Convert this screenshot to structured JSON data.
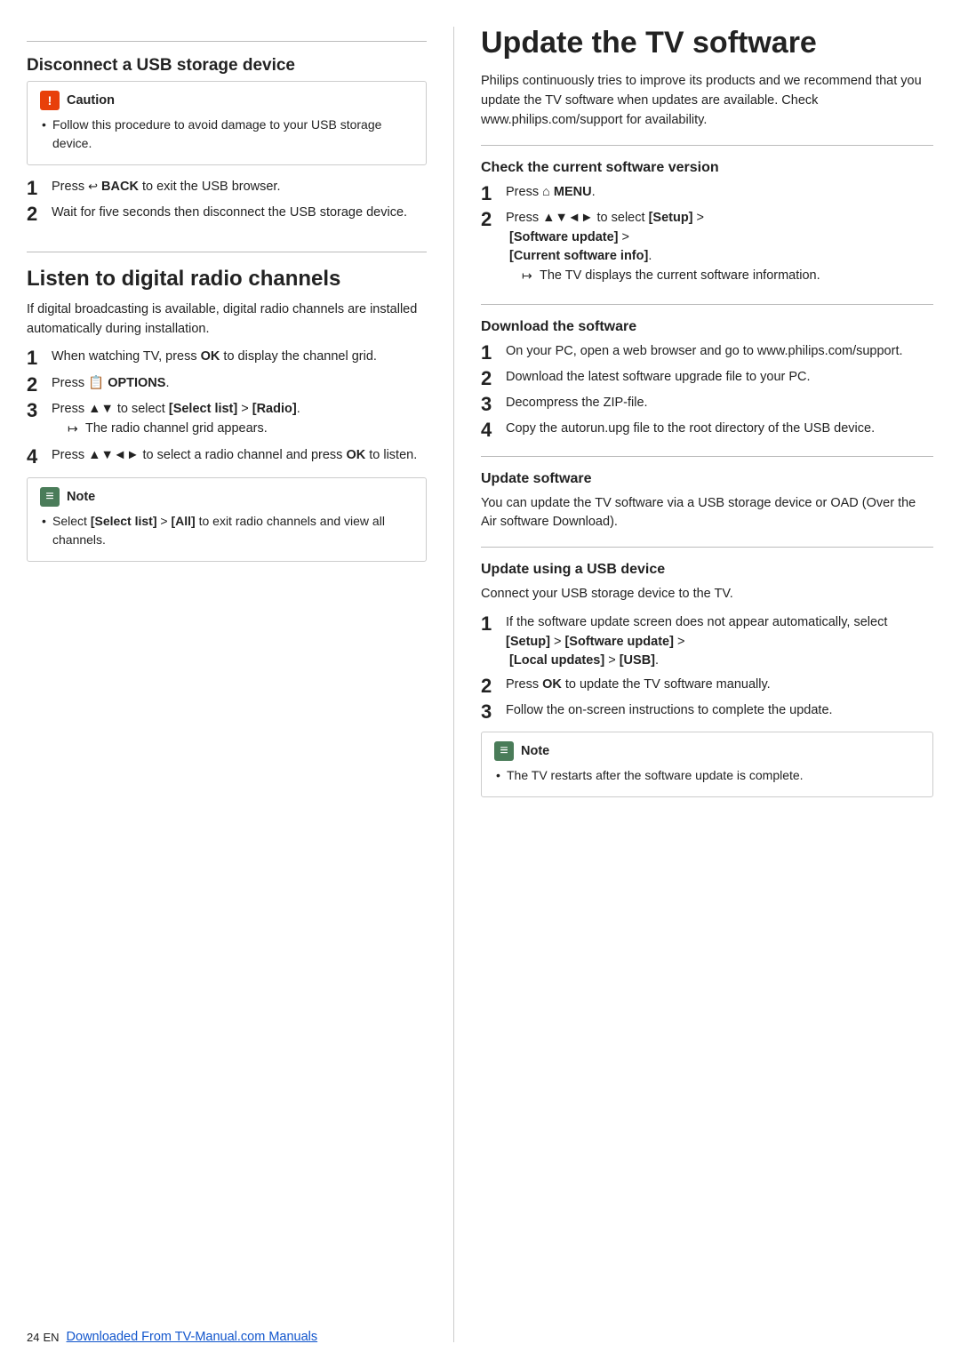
{
  "left": {
    "disconnect_section": {
      "title": "Disconnect a USB storage device",
      "caution": {
        "label": "Caution",
        "bullets": [
          "Follow this procedure to avoid damage to your USB storage device."
        ]
      },
      "steps": [
        {
          "num": "1",
          "text": "Press",
          "bold_part": " BACK",
          "rest": " to exit the USB browser."
        },
        {
          "num": "2",
          "text": "Wait for five seconds then disconnect the USB storage device."
        }
      ]
    },
    "radio_section": {
      "title": "Listen to digital radio channels",
      "intro": "If digital broadcasting is available, digital radio channels are installed automatically during installation.",
      "steps": [
        {
          "num": "1",
          "text": "When watching TV, press ",
          "bold": "OK",
          "rest": " to display the channel grid."
        },
        {
          "num": "2",
          "text": "Press",
          "bold": " OPTIONS",
          "rest": "."
        },
        {
          "num": "3",
          "text": "Press ▲▼ to select ",
          "bold1": "[Select list]",
          "middle": " > ",
          "bold2": "[Radio]",
          "rest": ".",
          "arrow": "The radio channel grid appears."
        },
        {
          "num": "4",
          "text": "Press ▲▼◄► to select a radio channel and press ",
          "bold": "OK",
          "rest": " to listen."
        }
      ],
      "note": {
        "bullets": [
          "Select [Select list] > [All] to exit radio channels and view all channels."
        ]
      }
    }
  },
  "right": {
    "main_title": "Update the TV software",
    "intro": "Philips continuously tries to improve its products and we recommend that you update the TV software when updates are available. Check www.philips.com/support for availability.",
    "check_section": {
      "title": "Check the current software version",
      "steps": [
        {
          "num": "1",
          "text": "Press",
          "bold": " MENU",
          "rest": "."
        },
        {
          "num": "2",
          "text": "Press ▲▼◄► to select ",
          "bold1": "[Setup]",
          "middle": " > ",
          "bold2": "[Software update]",
          "middle2": " > ",
          "bold3": "[Current software info]",
          "rest": ".",
          "arrow": "The TV displays the current software information."
        }
      ]
    },
    "download_section": {
      "title": "Download the software",
      "steps": [
        {
          "num": "1",
          "text": "On your PC, open a web browser and go to www.philips.com/support."
        },
        {
          "num": "2",
          "text": "Download the latest software upgrade file to your PC."
        },
        {
          "num": "3",
          "text": "Decompress the ZIP-file."
        },
        {
          "num": "4",
          "text": "Copy the autorun.upg file to the root directory of the USB device."
        }
      ]
    },
    "update_software_section": {
      "title": "Update software",
      "intro": "You can update the TV software via a USB storage device or OAD (Over the Air software Download)."
    },
    "update_usb_section": {
      "title": "Update using a USB device",
      "intro": "Connect your USB storage device to the TV.",
      "steps": [
        {
          "num": "1",
          "text": "If the software update screen does not appear automatically, select ",
          "bold1": "[Setup]",
          "middle": " > ",
          "bold2": "[Software update]",
          "middle2": " > ",
          "bold3": "[Local updates]",
          "middle3": " > ",
          "bold4": "[USB]",
          "rest": "."
        },
        {
          "num": "2",
          "text": "Press ",
          "bold": "OK",
          "rest": " to update the TV software manually."
        },
        {
          "num": "3",
          "text": "Follow the on-screen instructions to complete the update."
        }
      ],
      "note": {
        "bullets": [
          "The TV restarts after the software update is complete."
        ]
      }
    }
  },
  "footer": {
    "page_num": "24",
    "lang": "EN",
    "link_text": "Downloaded From TV-Manual.com Manuals",
    "link_url": "#"
  }
}
